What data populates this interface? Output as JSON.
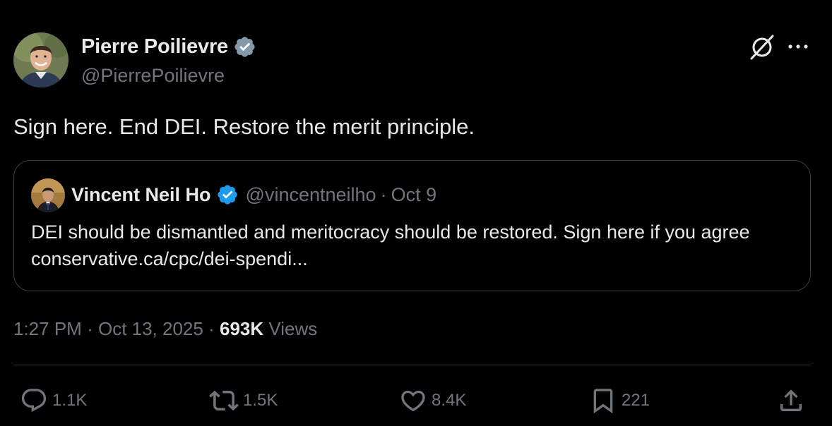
{
  "author": {
    "name": "Pierre Poilievre",
    "handle": "@PierrePoilievre",
    "verified_badge": "verified-gray-badge",
    "badge_color": "#829aab"
  },
  "tweet": {
    "text": "Sign here. End DEI. Restore the merit principle."
  },
  "quote": {
    "name": "Vincent Neil Ho",
    "handle": "@vincentneilho",
    "separator": "·",
    "date": "Oct 9",
    "text": "DEI should be dismantled and meritocracy should be restored. Sign here if you agree conservative.ca/cpc/dei-spendi...",
    "verified_badge": "verified-blue-badge",
    "badge_color": "#1d9bf0"
  },
  "meta": {
    "time": "1:27 PM",
    "sep1": "·",
    "date": "Oct 13, 2025",
    "sep2": "·",
    "views_count": "693K",
    "views_label": "Views"
  },
  "actions": {
    "replies": "1.1K",
    "reposts": "1.5K",
    "likes": "8.4K",
    "bookmarks": "221"
  },
  "icons": {
    "top_right": [
      "grok-icon",
      "more-icon"
    ],
    "actions": [
      "reply-icon",
      "retweet-icon",
      "heart-icon",
      "bookmark-icon",
      "share-icon"
    ]
  },
  "colors": {
    "background": "#000000",
    "text_primary": "#e7e9ea",
    "text_secondary": "#71767b",
    "border": "#3a3e42"
  }
}
